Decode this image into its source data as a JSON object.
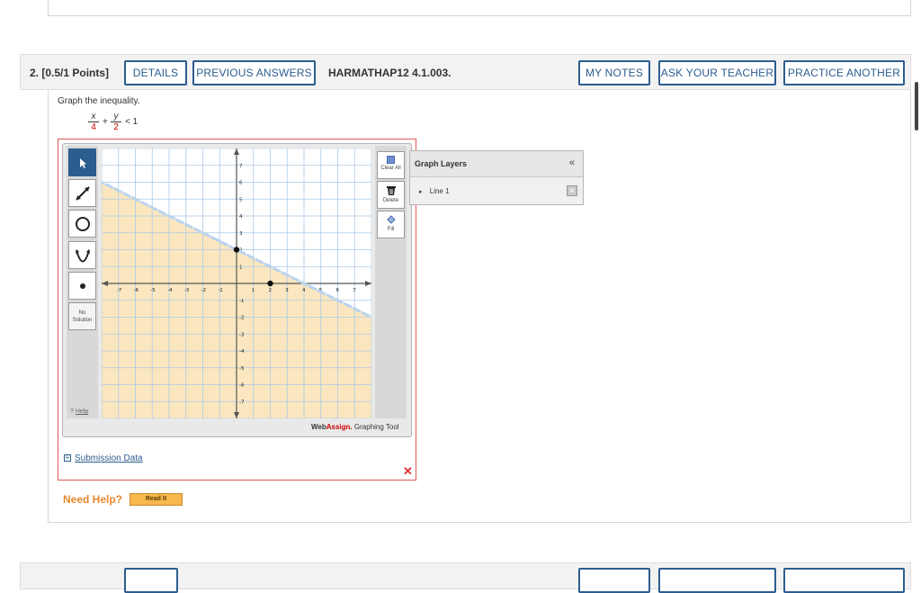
{
  "question": {
    "number_points": "2. [0.5/1 Points]",
    "code": "HARMATHAP12 4.1.003.",
    "buttons": {
      "details": "DETAILS",
      "previous_answers": "PREVIOUS ANSWERS",
      "my_notes": "MY NOTES",
      "ask_teacher": "ASK YOUR TEACHER",
      "practice_another": "PRACTICE ANOTHER"
    },
    "prompt": "Graph the inequality.",
    "inequality": {
      "x_num": "x",
      "x_den": "4",
      "plus": "+",
      "y_num": "y",
      "y_den": "2",
      "relation": "< 1"
    }
  },
  "tool": {
    "tools": [
      "pointer",
      "line",
      "circle",
      "parabola",
      "point"
    ],
    "no_solution_line1": "No",
    "no_solution_line2": "Solution",
    "help": "Help",
    "clear_all": "Clear All",
    "delete": "Delete",
    "fill": "Fill",
    "brand_web": "Web",
    "brand_assign": "Assign.",
    "brand_rest": " Graphing Tool",
    "x_ticks": [
      "-7",
      "-6",
      "-5",
      "-4",
      "-3",
      "-2",
      "-1",
      "1",
      "2",
      "3",
      "4",
      "5",
      "6",
      "7"
    ],
    "y_ticks": [
      "7",
      "6",
      "5",
      "4",
      "3",
      "2",
      "1",
      "-1",
      "-2",
      "-3",
      "-4",
      "-5",
      "-6",
      "-7"
    ],
    "colors": {
      "shade": "#fbe7bf",
      "boundary": "#b9d3ee",
      "grid": "#a9c9e8",
      "accent": "#2c5d8f"
    }
  },
  "chart_data": {
    "type": "scatter",
    "xlim": [
      -8,
      8
    ],
    "ylim": [
      -8,
      8
    ],
    "grid": true,
    "boundary_line": {
      "points": [
        [
          0,
          2
        ],
        [
          2,
          0
        ]
      ],
      "style": "dashed"
    },
    "shaded_region": "below-left of line",
    "points": [
      [
        0,
        2
      ],
      [
        2,
        0
      ]
    ]
  },
  "layers": {
    "title": "Graph Layers",
    "collapse": "«",
    "items": [
      "Line 1"
    ]
  },
  "submission": {
    "label": "Submission Data"
  },
  "help_section": {
    "need_help": "Need Help?",
    "read_it": "Read It"
  }
}
